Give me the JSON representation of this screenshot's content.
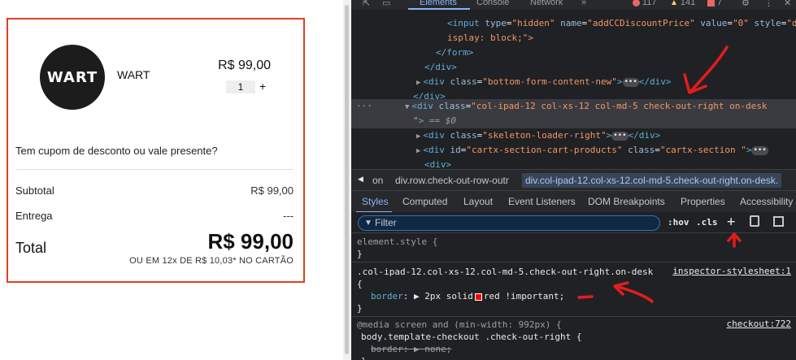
{
  "page": {
    "logo_text": "WART",
    "product_name": "WART",
    "product_price": "R$ 99,00",
    "quantity": "1",
    "qty_plus": "+",
    "coupon_text": "Tem cupom de desconto ou vale presente?",
    "subtotal_label": "Subtotal",
    "subtotal_value": "R$ 99,00",
    "shipping_label": "Entrega",
    "shipping_value": "---",
    "total_label": "Total",
    "total_value": "R$ 99,00",
    "installments": "OU EM 12x DE R$ 10,03* NO CARTÃO"
  },
  "devtools": {
    "top_tabs": [
      "Elements",
      "Console",
      "Network",
      "»"
    ],
    "errors": "117",
    "warnings": "141",
    "issues": "7",
    "dom": {
      "l1_tag": "<input",
      "l1_a1": " type",
      "l1_v1": "\"hidden\"",
      "l1_a2": " name",
      "l1_v2": "\"addCCDiscountPrice\"",
      "l1_a3": " value",
      "l1_v3": "\"0\"",
      "l1_a4": " style",
      "l1_v4": "\"d",
      "l2": "isplay: block;\">",
      "l3": "</form>",
      "l4": "</div>",
      "l5_open": "<div",
      "l5_attr": " class",
      "l5_val": "\"bottom-form-content-new\"",
      "l5_close": "</div>",
      "l6": "</div>",
      "sel_open": "<div",
      "sel_attr": " class",
      "sel_val": "\"col-ipad-12 col-xs-12 col-md-5 check-out-right on-desk",
      "sel_val2": "\"",
      "sel_eq": " == $0",
      "l8_open": "<div",
      "l8_attr": " class",
      "l8_val": "\"skeleton-loader-right\"",
      "l8_close": "</div>",
      "l9_open": "<div",
      "l9_attr1": " id",
      "l9_val1": "\"cartx-section-cart-products\"",
      "l9_attr2": " class",
      "l9_val2": "\"cartx-section \"",
      "l10": "<div>"
    },
    "breadcrumb": {
      "arrow": "◀",
      "item1": "on",
      "item2": "div.row.check-out-row-outr",
      "item3": "div.col-ipad-12.col-xs-12.col-md-5.check-out-right.on-desk."
    },
    "sub_tabs": [
      "Styles",
      "Computed",
      "Layout",
      "Event Listeners",
      "DOM Breakpoints",
      "Properties",
      "Accessibility"
    ],
    "filter_placeholder": "Filter",
    "hov": ":hov",
    "cls": ".cls",
    "styles": {
      "element_style": "element.style {",
      "close": "}",
      "rule_selector": ".col-ipad-12.col-xs-12.col-md-5.check-out-right.on-desk",
      "rule_source": "inspector-stylesheet:1",
      "open": "{",
      "prop": "border",
      "val_pre": "▶ 2px solid",
      "val_post": "red !important;",
      "media": "@media screen and (min-width: 992px) {",
      "media_source": "checkout:722",
      "rule2_selector": "body.template-checkout .check-out-right {",
      "rule2_prop": "border: ▶ none;",
      "rule2_close": "}"
    },
    "colors": {
      "accent": "#8ab4f8",
      "border_red": "#e0401f",
      "annotation": "#e21d1d"
    }
  }
}
